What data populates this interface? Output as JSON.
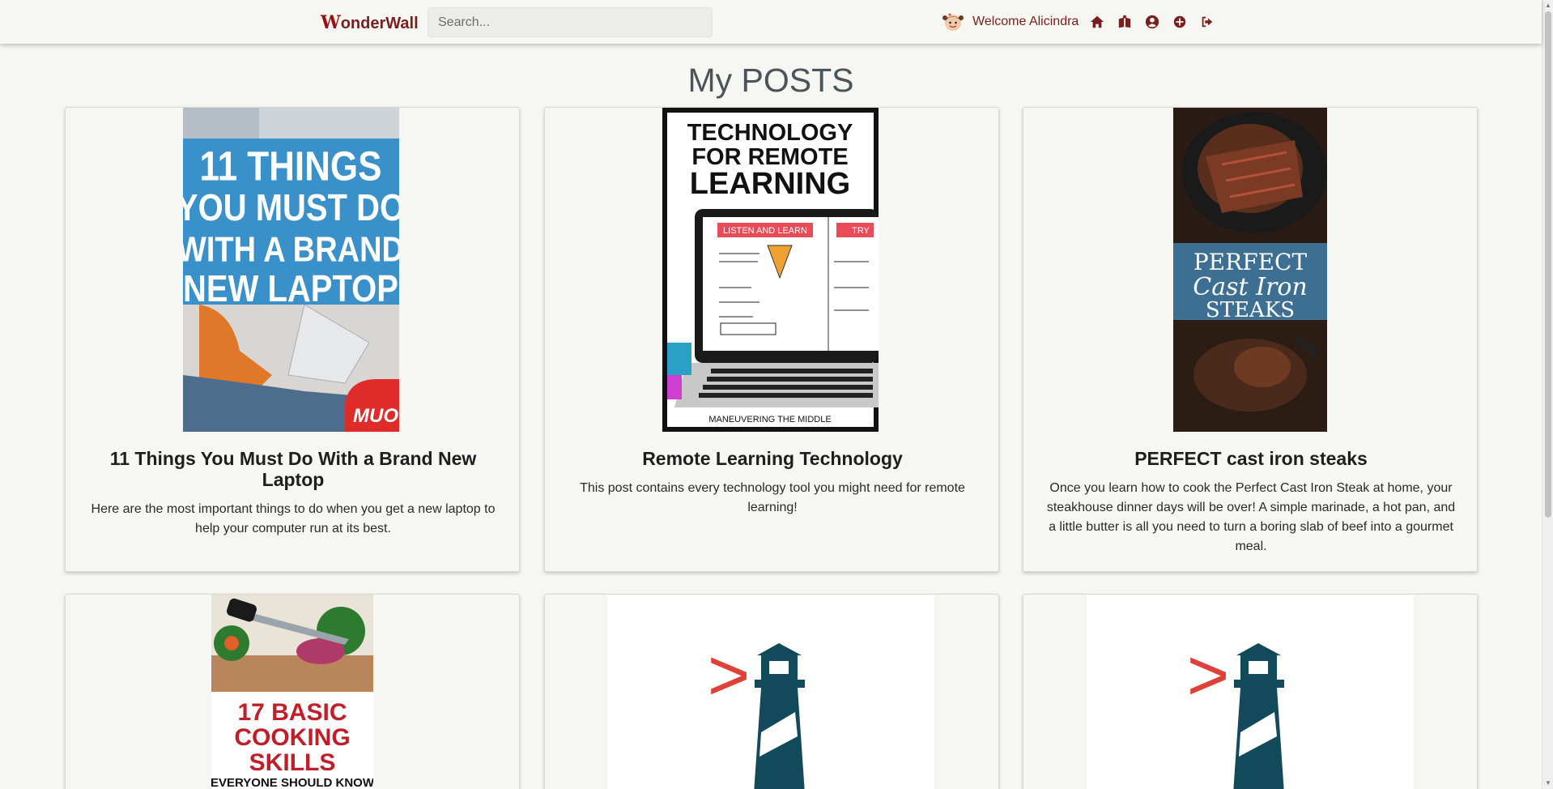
{
  "navbar": {
    "brand_initial": "W",
    "brand_rest": "onderWall",
    "search_placeholder": "Search...",
    "welcome": "Welcome Alicindra",
    "icons": [
      "avatar-icon",
      "home-icon",
      "book-icon",
      "user-circle-icon",
      "plus-circle-icon",
      "sign-out-icon"
    ]
  },
  "page_title": "My POSTS",
  "posts": [
    {
      "title": "11 Things You Must Do With a Brand New Laptop",
      "text": "Here are the most important things to do when you get a new laptop to help your computer run at its best.",
      "image": {
        "lines": [
          "11 THINGS",
          "YOU MUST DO",
          "WITH A BRAND",
          "NEW LAPTOP"
        ],
        "badge": "MUO"
      }
    },
    {
      "title": "Remote Learning Technology",
      "text": "This post contains every technology tool you might need for remote learning!",
      "image": {
        "lines": [
          "TECHNOLOGY",
          "FOR REMOTE",
          "LEARNING"
        ],
        "screen_header": "LISTEN AND LEARN",
        "screen_tab": "TRY",
        "footer": "MANEUVERING THE MIDDLE"
      }
    },
    {
      "title": "PERFECT cast iron steaks",
      "text": "Once you learn how to cook the Perfect Cast Iron Steak at home, your steakhouse dinner days will be over! A simple marinade, a hot pan, and a little butter is all you need to turn a boring slab of beef into a gourmet meal.",
      "image": {
        "lines": [
          "PERFECT",
          "Cast Iron",
          "STEAKS"
        ]
      }
    },
    {
      "title": "",
      "text": "",
      "image": {
        "lines": [
          "17 BASIC",
          "COOKING",
          "SKILLS"
        ],
        "sub": "EVERYONE SHOULD KNOW"
      }
    },
    {
      "title": "",
      "text": "",
      "image": {
        "logo": ">"
      }
    },
    {
      "title": "",
      "text": "",
      "image": {
        "logo": ">"
      }
    }
  ],
  "colors": {
    "brand": "#7a1f1f",
    "background": "#f6f6f2",
    "title": "#4a5459"
  }
}
